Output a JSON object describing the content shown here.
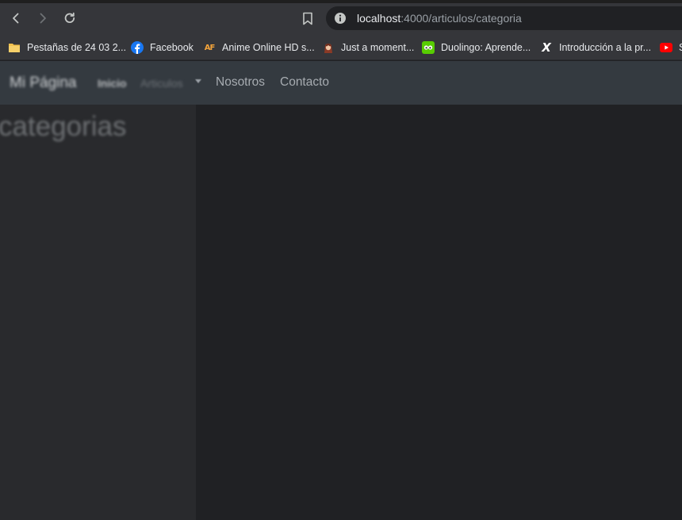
{
  "browser": {
    "url_host": "localhost",
    "url_rest": ":4000/articulos/categoria"
  },
  "bookmarks": [
    {
      "label": "Pestañas de 24 03 2...",
      "icon": "folder-icon"
    },
    {
      "label": "Facebook",
      "icon": "facebook-icon"
    },
    {
      "label": "Anime Online HD s...",
      "icon": "af-logo-icon"
    },
    {
      "label": "Just a moment...",
      "icon": "character-avatar-icon"
    },
    {
      "label": "Duolingo: Aprende...",
      "icon": "duolingo-icon"
    },
    {
      "label": "Introducción a la pr...",
      "icon": "x-logo-icon"
    },
    {
      "label": "S",
      "icon": "youtube-icon"
    }
  ],
  "site": {
    "brand": "Mi Página",
    "nav": {
      "inicio": "Inicio",
      "articulos": "Articulos",
      "nosotros": "Nosotros",
      "contacto": "Contacto"
    },
    "sidebar_title": "categorias"
  },
  "colors": {
    "navbar_bg": "#343a40",
    "sidebar_bg": "#292a2d",
    "main_bg": "#202124"
  }
}
